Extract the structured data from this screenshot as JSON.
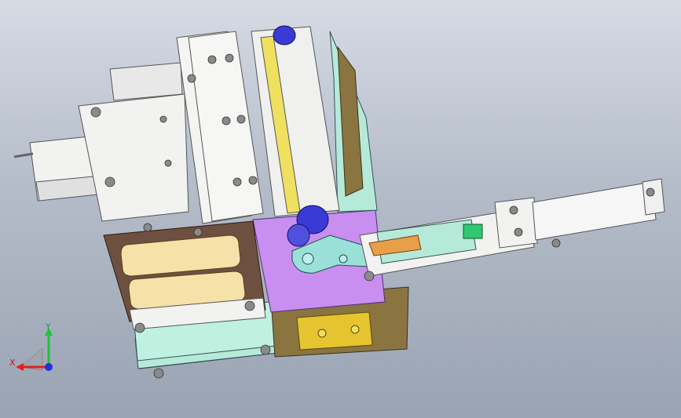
{
  "triad": {
    "x_label": "X",
    "y_label": "Y",
    "z_label": ""
  },
  "colors": {
    "background_top": "#d6dbe4",
    "background_bottom": "#9aa3b2",
    "white_part": "#f2f2f0",
    "cyan_plate": "#b6ead8",
    "purple_plate": "#c88ef0",
    "brown_block": "#6e5040",
    "cream_part": "#f6e2a8",
    "yellow_block": "#e6c430",
    "blue_roller": "#3a3ad6",
    "orange_part": "#e8a048",
    "green_part": "#30c870",
    "olive_plate": "#8a7440",
    "axis_x": "#e02020",
    "axis_y": "#20c040",
    "axis_z": "#2030e0"
  }
}
